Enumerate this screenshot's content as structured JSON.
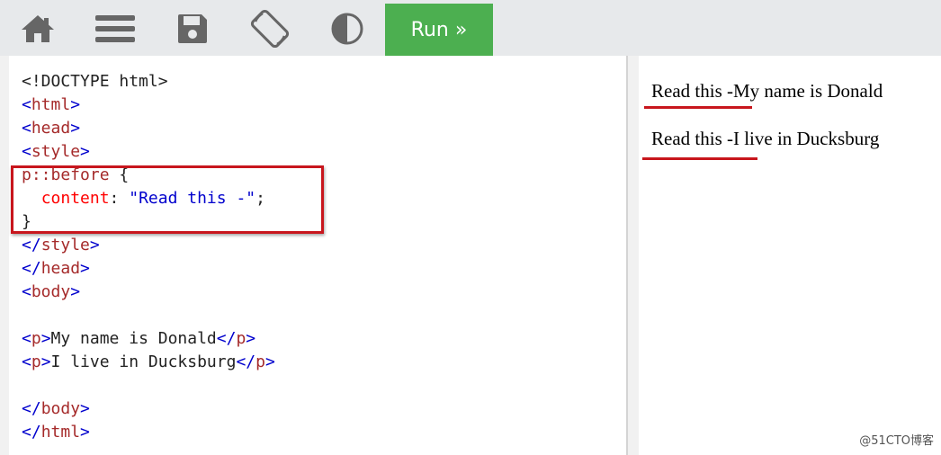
{
  "toolbar": {
    "icons": [
      "home-icon",
      "menu-icon",
      "save-icon",
      "rotate-icon",
      "theme-contrast-icon"
    ],
    "run_label": "Run »",
    "run_color": "#4caf50"
  },
  "code": {
    "lines": [
      "<!DOCTYPE html>",
      "<html>",
      "<head>",
      "<style>",
      "p::before {",
      "  content: \"Read this -\";",
      "}",
      "</style>",
      "</head>",
      "<body>",
      "",
      "<p>My name is Donald</p>",
      "<p>I live in Ducksburg</p>",
      "",
      "</body>",
      "</html>"
    ],
    "doctype": "<!DOCTYPE html>",
    "selector": "p::before",
    "property": "content",
    "value": "\"Read this -\"",
    "p1_text": "My name is Donald",
    "p2_text": "I live in Ducksburg"
  },
  "result": {
    "line1": "Read this -My name is Donald",
    "line2": "Read this -I live in Ducksburg"
  },
  "watermark": "@51CTO博客",
  "colors": {
    "highlight": "#c8161d",
    "run_button": "#4caf50"
  }
}
